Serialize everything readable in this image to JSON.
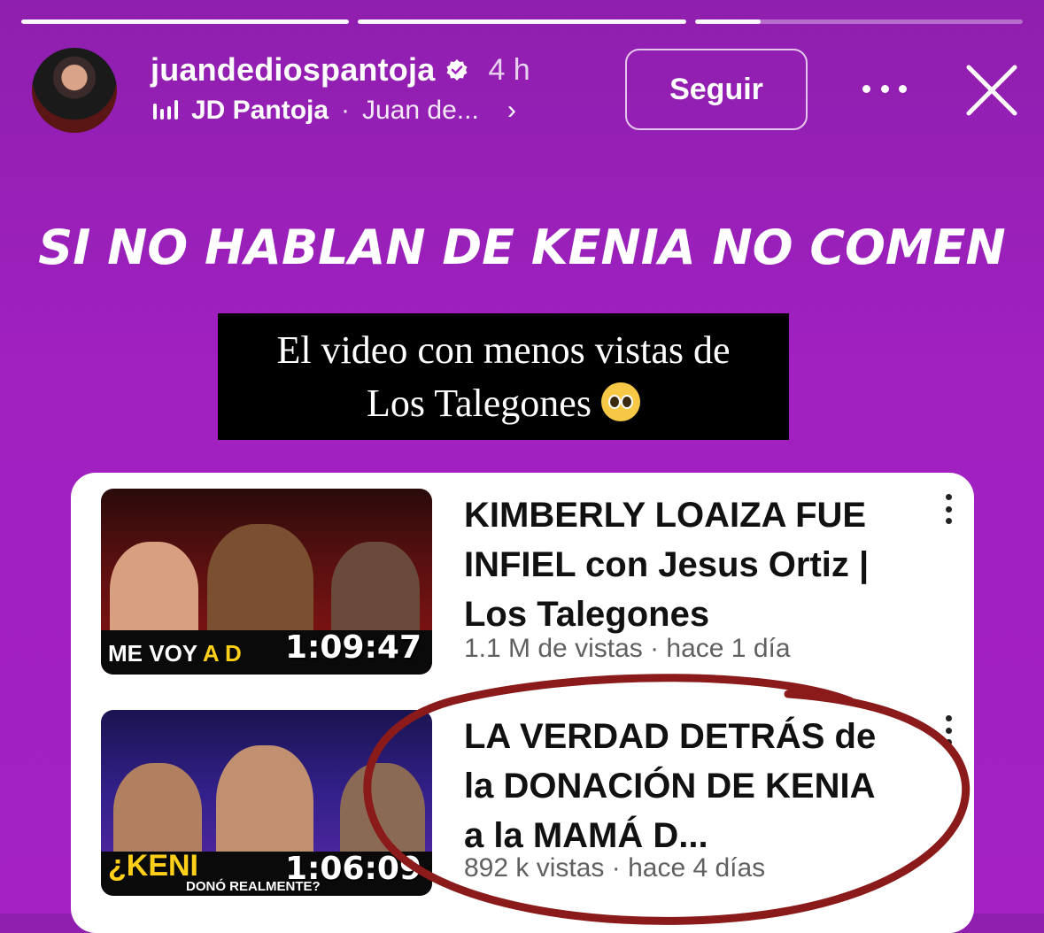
{
  "story": {
    "progress": [
      1.0,
      1.0,
      0.2
    ]
  },
  "header": {
    "username": "juandediospantoja",
    "time_ago": "4 h",
    "music_artist": "JD Pantoja",
    "music_separator": "·",
    "music_track": "Juan de...",
    "follow_label": "Seguir"
  },
  "headline": "SI NO HABLAN DE KENIA NO COMEN",
  "caption": {
    "line1": "El video con menos vistas de",
    "line2": "Los Talegones"
  },
  "videos": [
    {
      "title": "KIMBERLY LOAIZA FUE INFIEL con Jesus Ortiz | Los Talegones",
      "meta": "1.1 M de vistas · hace 1 día",
      "duration": "1:09:47",
      "thumb_text_white": "ME VOY ",
      "thumb_text_yellow": "A D"
    },
    {
      "title": "LA VERDAD DETRÁS de la DONACIÓN DE KENIA a la MAMÁ D...",
      "meta": "892 k vistas · hace 4 días",
      "duration": "1:06:09",
      "thumb_text_white": "¿KENI",
      "thumb_text_yellow": "",
      "thumb_subtext": "DONÓ REALMENTE?"
    }
  ],
  "colors": {
    "background": "#a020c0",
    "annotation_circle": "#8b1a1a"
  },
  "icons": {
    "verified": "verified-badge-icon",
    "music": "audio-bars-icon",
    "more": "more-horizontal-icon",
    "close": "close-icon",
    "kebab": "more-vertical-icon"
  }
}
